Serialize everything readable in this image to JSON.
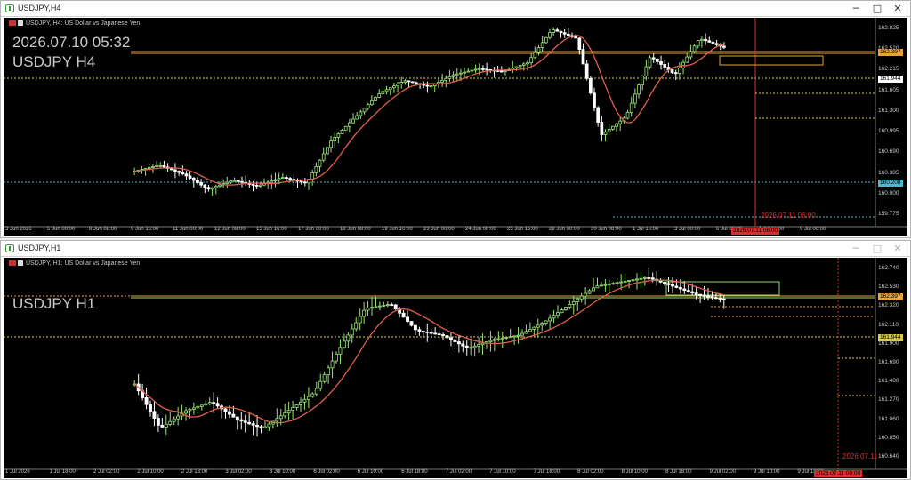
{
  "top_window": {
    "title": "USDJPY,H4",
    "symbol_label": "USDJPY, H4:  US Dollar vs Japanese Yen",
    "datetime": "2026.07.10 05:32",
    "pair_label": "USDJPY H4",
    "price_axis": [
      "162.825",
      "162.520",
      "162.215",
      "161.605",
      "161.300",
      "160.995",
      "160.690",
      "160.385",
      "160.000",
      "159.775"
    ],
    "badges": {
      "current": "162.397",
      "level_white": "161.944",
      "level_cyan": "160.208"
    },
    "time_axis": [
      "3 Jun 2026",
      "5 Jun 00:00",
      "8 Jun 08:00",
      "9 Jun 16:00",
      "11 Jun 00:00",
      "12 Jun 08:00",
      "15 Jun 16:00",
      "17 Jun 00:00",
      "18 Jun 08:00",
      "19 Jun 16:00",
      "23 Jun 00:00",
      "24 Jun 08:00",
      "25 Jun 16:00",
      "29 Jun 00:00",
      "30 Jun 08:00",
      "1 Jul 16:00",
      "3 Jul 00:00",
      "6 Jul 08:00",
      "7 Jul 16:00",
      "9 Jul 00:00"
    ],
    "future_time_label": "2026.07.11 06:00",
    "future_time_badge": "2026.07.11 06:00"
  },
  "bottom_window": {
    "title": "USDJPY,H1",
    "symbol_label": "USDJPY, H1:  US Dollar vs Japanese Yen",
    "pair_label": "USDJPY H1",
    "price_axis": [
      "162.740",
      "162.530",
      "162.320",
      "162.110",
      "161.900",
      "161.690",
      "161.480",
      "161.270",
      "161.060",
      "160.850",
      "160.640"
    ],
    "badges": {
      "current": "162.397",
      "level_yellow": "161.944"
    },
    "time_axis": [
      "1 Jul 2026",
      "1 Jul 18:00",
      "2 Jul 02:00",
      "2 Jul 10:00",
      "2 Jul 18:00",
      "3 Jul 02:00",
      "3 Jul 10:00",
      "6 Jul 02:00",
      "6 Jul 10:00",
      "6 Jul 18:00",
      "7 Jul 02:00",
      "7 Jul 10:00",
      "7 Jul 18:00",
      "8 Jul 02:00",
      "8 Jul 10:00",
      "8 Jul 18:00",
      "9 Jul 02:00",
      "9 Jul 10:00",
      "9 Jul 18:00"
    ],
    "future_time_label": "2026.07.11",
    "future_time_badge": "2026.07.11 00:00"
  },
  "window_buttons": {
    "minimize": "─",
    "maximize": "□",
    "close": "✕"
  },
  "colors": {
    "bull": "#9be37b",
    "bear": "#ffffff",
    "ma": "#e0604a",
    "level_orange": "#e8a33a",
    "level_yellow": "#d6c84a",
    "level_green": "#8fdc6a",
    "cyan": "#4fb8c8",
    "red": "#d62f2f"
  }
}
